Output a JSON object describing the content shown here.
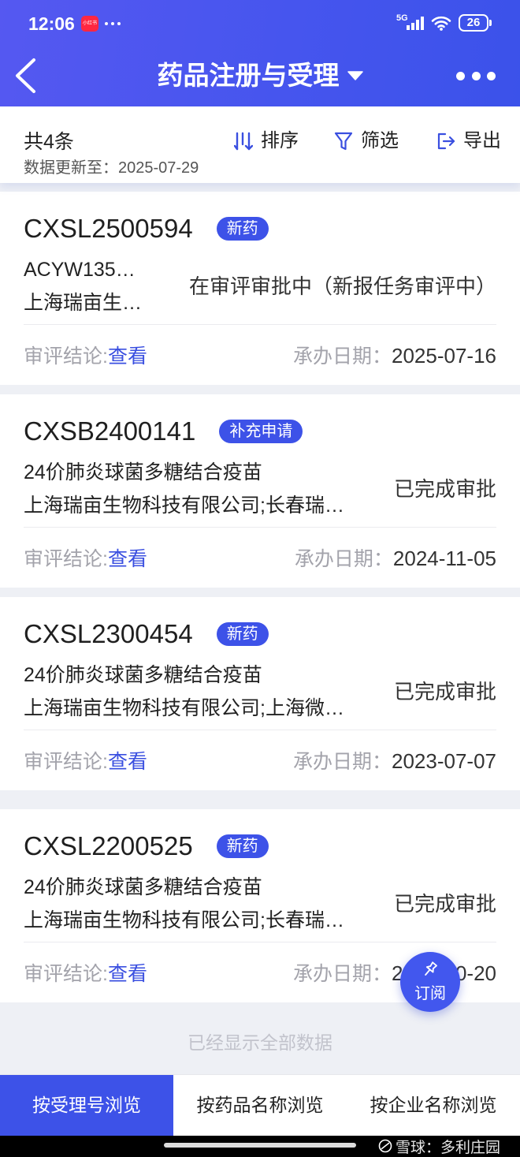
{
  "status_bar": {
    "time": "12:06",
    "app_icon": {
      "name": "xiaohongshu-icon",
      "label": "小红书"
    },
    "notification_more_icon": "more-notifications-icon",
    "network": "5G",
    "signal_icon": "signal-bars-icon",
    "wifi_icon": "wifi-icon",
    "battery": "26"
  },
  "header": {
    "title": "药品注册与受理",
    "back_icon": "back-chevron-icon",
    "dropdown_icon": "caret-down-icon",
    "more_icon": "more-dots-icon"
  },
  "toolbar": {
    "total": "共4条",
    "updated": "数据更新至：2025-07-29",
    "sort": {
      "label": "排序",
      "icon": "sort-icon"
    },
    "filter": {
      "label": "筛选",
      "icon": "filter-icon"
    },
    "export": {
      "label": "导出",
      "icon": "export-icon"
    }
  },
  "records": [
    {
      "id": "CXSL2500594",
      "type": "新药",
      "line1": "ACYW135…",
      "line2": "上海瑞亩生…",
      "status": "在审评审批中（新报任务审评中）",
      "conclusion_label": "审评结论:",
      "conclusion_link": "查看",
      "date_label": "承办日期：",
      "date": "2025-07-16"
    },
    {
      "id": "CXSB2400141",
      "type": "补充申请",
      "line1": "24价肺炎球菌多糖结合疫苗",
      "line2": "上海瑞亩生物科技有限公司;长春瑞…",
      "status": "已完成审批",
      "conclusion_label": "审评结论:",
      "conclusion_link": "查看",
      "date_label": "承办日期：",
      "date": "2024-11-05"
    },
    {
      "id": "CXSL2300454",
      "type": "新药",
      "line1": "24价肺炎球菌多糖结合疫苗",
      "line2": "上海瑞亩生物科技有限公司;上海微…",
      "status": "已完成审批",
      "conclusion_label": "审评结论:",
      "conclusion_link": "查看",
      "date_label": "承办日期：",
      "date": "2023-07-07"
    },
    {
      "id": "CXSL2200525",
      "type": "新药",
      "line1": "24价肺炎球菌多糖结合疫苗",
      "line2": "上海瑞亩生物科技有限公司;长春瑞…",
      "status": "已完成审批",
      "conclusion_label": "审评结论:",
      "conclusion_link": "查看",
      "date_label": "承办日期：",
      "date": "2022-10-20"
    }
  ],
  "list_end_text": "已经显示全部数据",
  "fab": {
    "label": "订阅",
    "icon": "pin-icon"
  },
  "tabs": [
    {
      "label": "按受理号浏览",
      "active": true
    },
    {
      "label": "按药品名称浏览",
      "active": false
    },
    {
      "label": "按企业名称浏览",
      "active": false
    }
  ],
  "watermark": {
    "text": "雪球：多利庄园",
    "icon": "xueqiu-logo-icon"
  },
  "colors": {
    "primary": "#3d52e8",
    "header_start": "#5558f1",
    "header_end": "#3b52ea",
    "link": "#3a4fe0",
    "muted_text": "#a3a3ab",
    "page_background": "#eef0f5",
    "app_icon_red": "#ff2741"
  }
}
